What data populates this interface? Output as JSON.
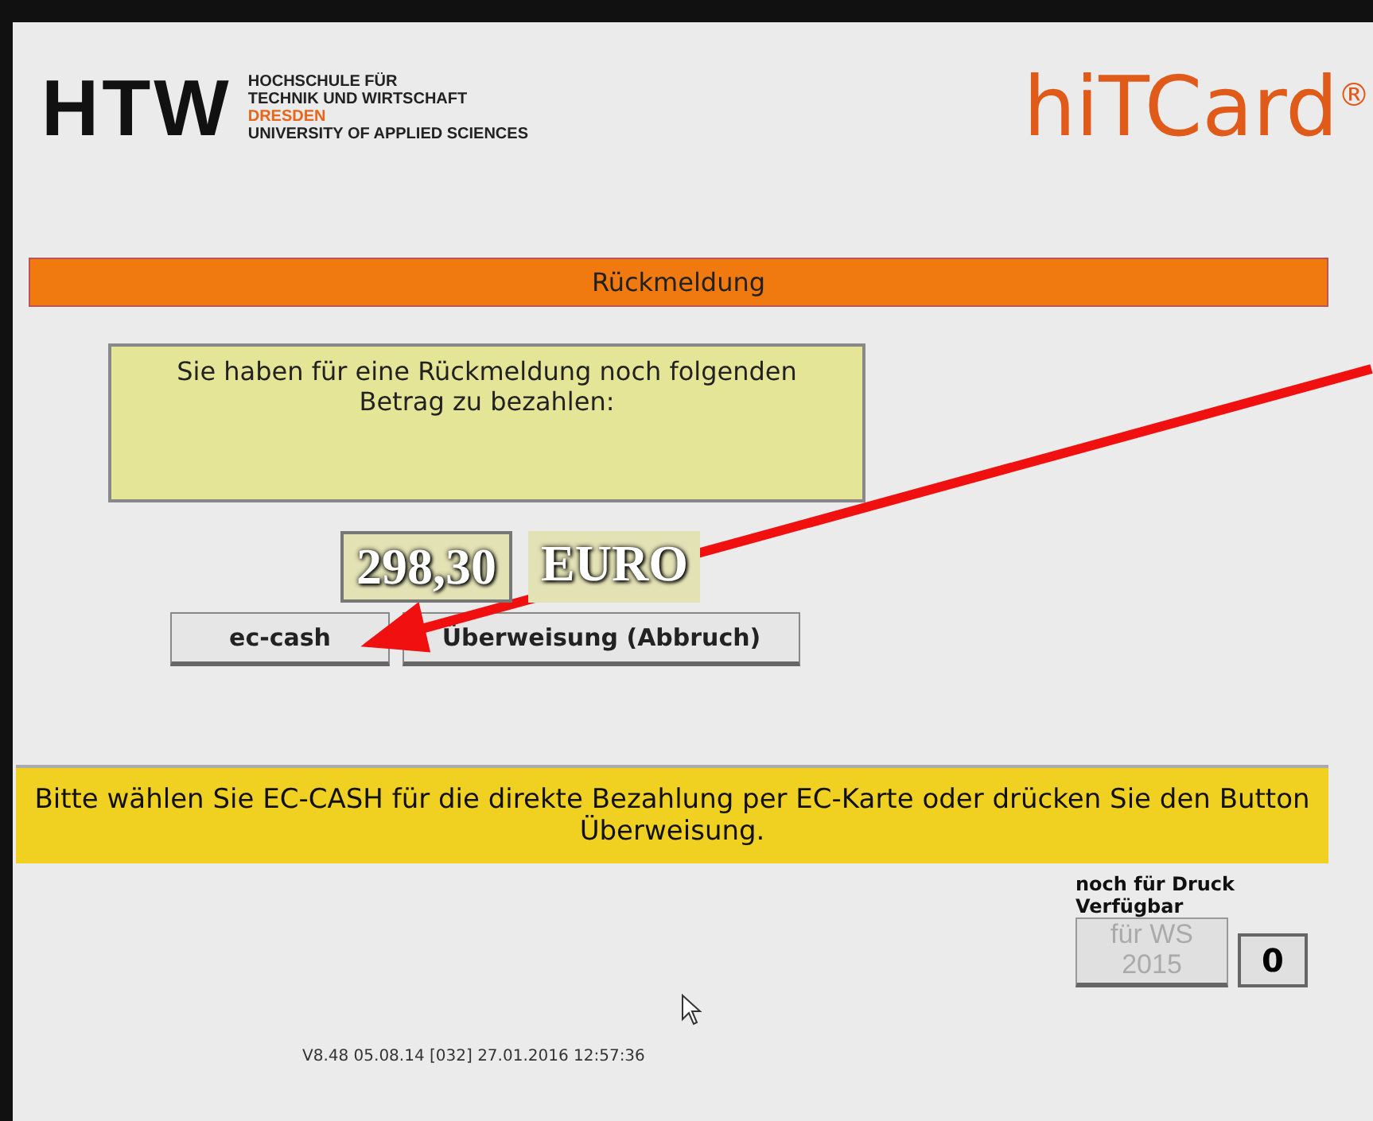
{
  "logo": {
    "mark": "HTW",
    "lines": [
      "HOCHSCHULE FÜR",
      "TECHNIK UND WIRTSCHAFT",
      "DRESDEN",
      "UNIVERSITY OF APPLIED SCIENCES"
    ]
  },
  "brand": {
    "text": "hiTCard",
    "sup": "®"
  },
  "header": {
    "title": "Rückmeldung"
  },
  "message": "Sie haben für eine Rückmeldung noch folgenden Betrag zu bezahlen:",
  "amount": {
    "value": "298,30",
    "currency": "EURO"
  },
  "buttons": [
    {
      "label": "ec-cash"
    },
    {
      "label": "Überweisung (Abbruch)"
    }
  ],
  "notice": "Bitte wählen Sie EC-CASH für die direkte Bezahlung per EC-Karte oder drücken Sie den Button Überweisung.",
  "print": {
    "label_lines": [
      "noch für Druck",
      "Verfügbar"
    ],
    "button": {
      "label_lines": [
        "für WS",
        "2015"
      ],
      "disabled": true
    },
    "count": "0"
  },
  "footer": "V8.48 05.08.14 [032] 27.01.2016 12:57:36"
}
